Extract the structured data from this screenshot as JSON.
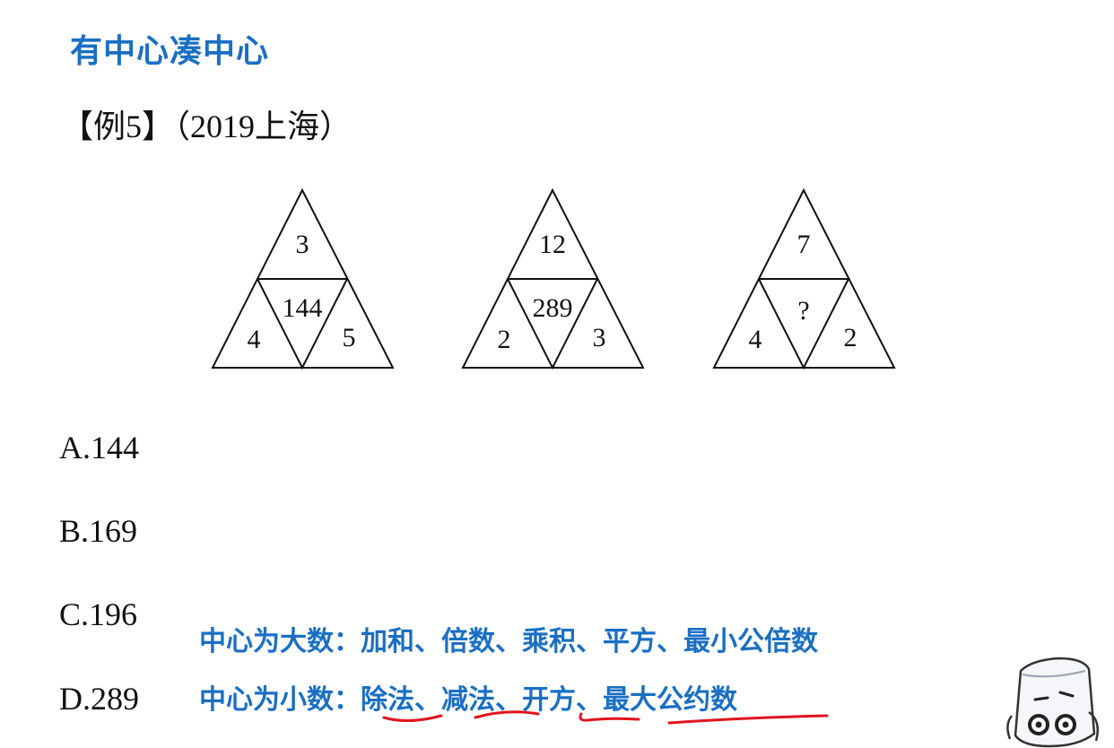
{
  "title": "有中心凑中心",
  "example": "【例5】（2019上海）",
  "triangles": [
    {
      "top": "3",
      "center": "144",
      "left": "4",
      "right": "5"
    },
    {
      "top": "12",
      "center": "289",
      "left": "2",
      "right": "3"
    },
    {
      "top": "7",
      "center": "?",
      "left": "4",
      "right": "2"
    }
  ],
  "options": [
    "A.144",
    "B.169",
    "C.196",
    "D.289"
  ],
  "hints": {
    "big": "中心为大数：加和、倍数、乘积、平方、最小公倍数",
    "small": "中心为小数：除法、减法、开方、最大公约数"
  },
  "colors": {
    "accent": "#1a6fc4",
    "underline": "#e0141e",
    "text": "#111111"
  }
}
